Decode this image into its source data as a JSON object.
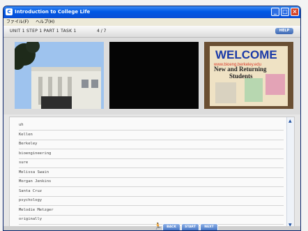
{
  "window": {
    "title": "Introduction to College Life",
    "min_label": "_",
    "max_label": "□",
    "close_label": "×"
  },
  "menu": {
    "items": [
      "ファイル(F)",
      "ヘルプ(H)"
    ]
  },
  "header": {
    "breadcrumb": "UNIT 1   STEP 1   PART 1   TASK 1",
    "page_count": "4 / 7",
    "help_label": "HELP"
  },
  "photos": {
    "sign_welcome": "WELCOME",
    "sign_url": "www.bioeng.berkeley.edu",
    "sign_subtitle_1": "New and Returning",
    "sign_subtitle_2": "Students"
  },
  "words": [
    "uh",
    "Kellen",
    "Berkeley",
    "bioengineering",
    "sure",
    "Melissa Swain",
    "Morgan Jenkins",
    "Santa Cruz",
    "psychology",
    "Melodie Metzger",
    "originally"
  ],
  "nav": {
    "back_label": "BACK",
    "start_label": "START",
    "next_label": "NEXT"
  },
  "icons": {
    "scroll_up": "▲",
    "scroll_down": "▼",
    "runner": "🏃"
  }
}
